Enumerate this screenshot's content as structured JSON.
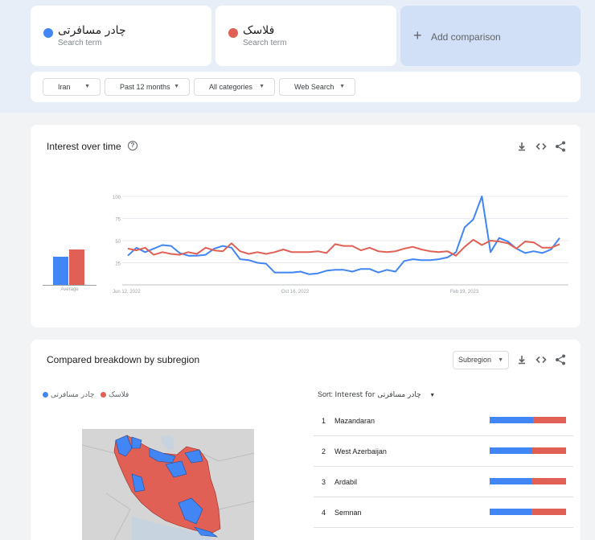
{
  "colors": {
    "term1": "#4285f4",
    "term2": "#e06055",
    "add_bg": "#d2e0f7"
  },
  "terms": [
    {
      "name": "چادر مسافرتی",
      "sub": "Search term"
    },
    {
      "name": "فلاسک",
      "sub": "Search term"
    }
  ],
  "add_comparison": {
    "icon": "plus-icon",
    "label": "Add comparison"
  },
  "filters": [
    {
      "label": "Iran"
    },
    {
      "label": "Past 12 months"
    },
    {
      "label": "All categories"
    },
    {
      "label": "Web Search"
    }
  ],
  "interest": {
    "title": "Interest over time",
    "average_label": "Average",
    "icons": [
      "help-icon",
      "download-icon",
      "embed-icon",
      "share-icon"
    ]
  },
  "chart_data": {
    "type": "line",
    "title": "Interest over time",
    "ylim": [
      0,
      100
    ],
    "yticks": [
      100,
      75,
      50,
      25
    ],
    "xtick_labels": [
      "Jun 12, 2022",
      "Oct 16, 2022",
      "Feb 19, 2023"
    ],
    "grid": true,
    "averages": [
      32,
      40
    ],
    "series": [
      {
        "name": "چادر مسافرتی",
        "values": [
          33,
          42,
          37,
          41,
          45,
          44,
          36,
          33,
          33,
          34,
          41,
          44,
          42,
          29,
          28,
          25,
          24,
          14,
          14,
          14,
          15,
          12,
          13,
          16,
          17,
          17,
          15,
          18,
          18,
          14,
          17,
          15,
          27,
          29,
          28,
          28,
          29,
          31,
          37,
          65,
          74,
          100,
          37,
          53,
          49,
          41,
          36,
          38,
          36,
          40,
          53
        ]
      },
      {
        "name": "فلاسک",
        "values": [
          41,
          39,
          42,
          34,
          37,
          35,
          34,
          37,
          35,
          42,
          39,
          38,
          47,
          38,
          35,
          37,
          35,
          37,
          40,
          37,
          37,
          37,
          38,
          36,
          46,
          44,
          44,
          39,
          42,
          38,
          37,
          38,
          41,
          43,
          40,
          38,
          37,
          38,
          33,
          43,
          51,
          45,
          50,
          49,
          47,
          41,
          49,
          48,
          42,
          42,
          46
        ]
      }
    ]
  },
  "breakdown": {
    "title": "Compared breakdown by subregion",
    "subregion_label": "Subregion",
    "legend": [
      {
        "name": "چادر مسافرتی"
      },
      {
        "name": "فلاسک"
      }
    ],
    "sort_label": "Sort:",
    "sort_value": "Interest for چادر مسافرتی",
    "rows": [
      {
        "rank": "1",
        "name": "Mazandaran",
        "share": 0.57
      },
      {
        "rank": "2",
        "name": "West Azerbaijan",
        "share": 0.56
      },
      {
        "rank": "3",
        "name": "Ardabil",
        "share": 0.55
      },
      {
        "rank": "4",
        "name": "Semnan",
        "share": 0.55
      }
    ]
  }
}
